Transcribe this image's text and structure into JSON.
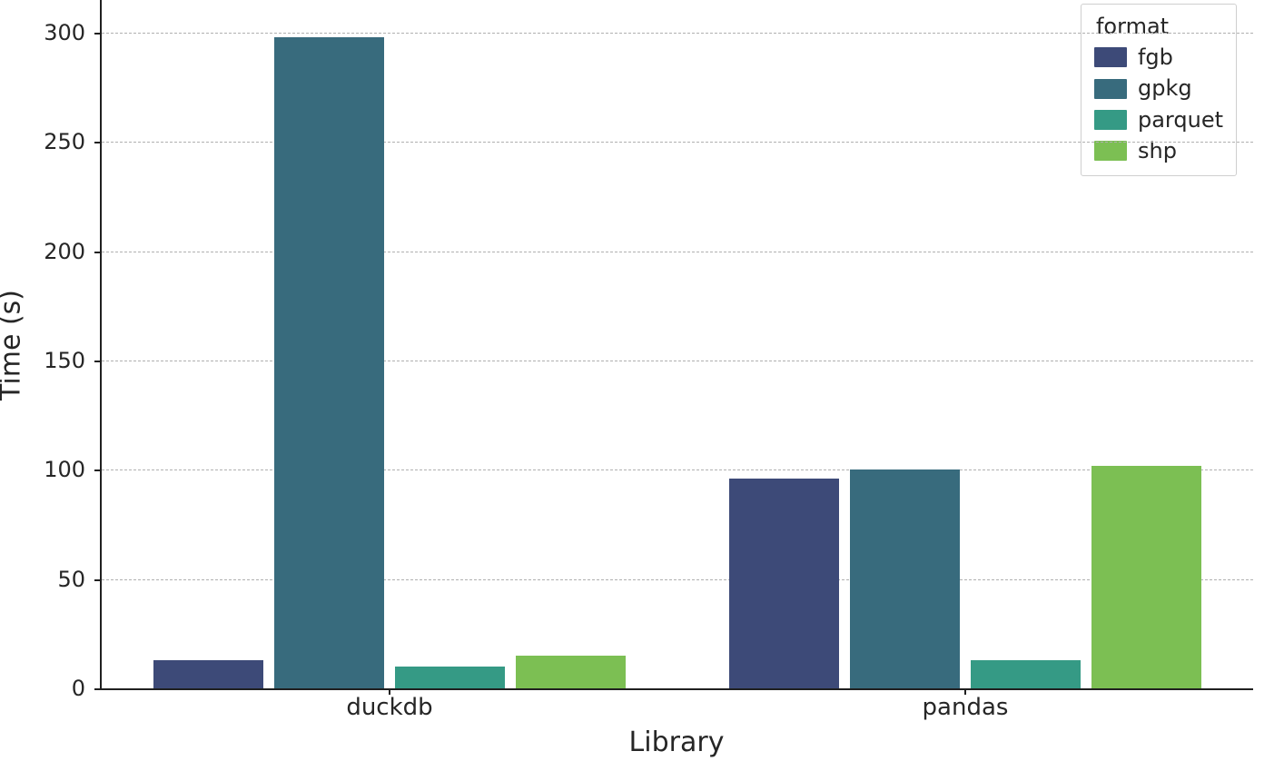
{
  "chart_data": {
    "type": "bar",
    "title": "",
    "xlabel": "Library",
    "ylabel": "Time (s)",
    "categories": [
      "duckdb",
      "pandas"
    ],
    "y_ticks": [
      0,
      50,
      100,
      150,
      200,
      250,
      300
    ],
    "ylim": [
      0,
      315
    ],
    "legend_title": "format",
    "series": [
      {
        "name": "fgb",
        "color": "#3d4a78",
        "values": [
          13,
          96
        ]
      },
      {
        "name": "gpkg",
        "color": "#386b7d",
        "values": [
          298,
          100
        ]
      },
      {
        "name": "parquet",
        "color": "#359a85",
        "values": [
          10,
          13
        ]
      },
      {
        "name": "shp",
        "color": "#7cbf53",
        "values": [
          15,
          102
        ]
      }
    ],
    "bar_layout": {
      "group_centers_frac": [
        0.25,
        0.75
      ],
      "bar_width_frac": 0.095,
      "group_gap_frac": 0.01
    }
  }
}
